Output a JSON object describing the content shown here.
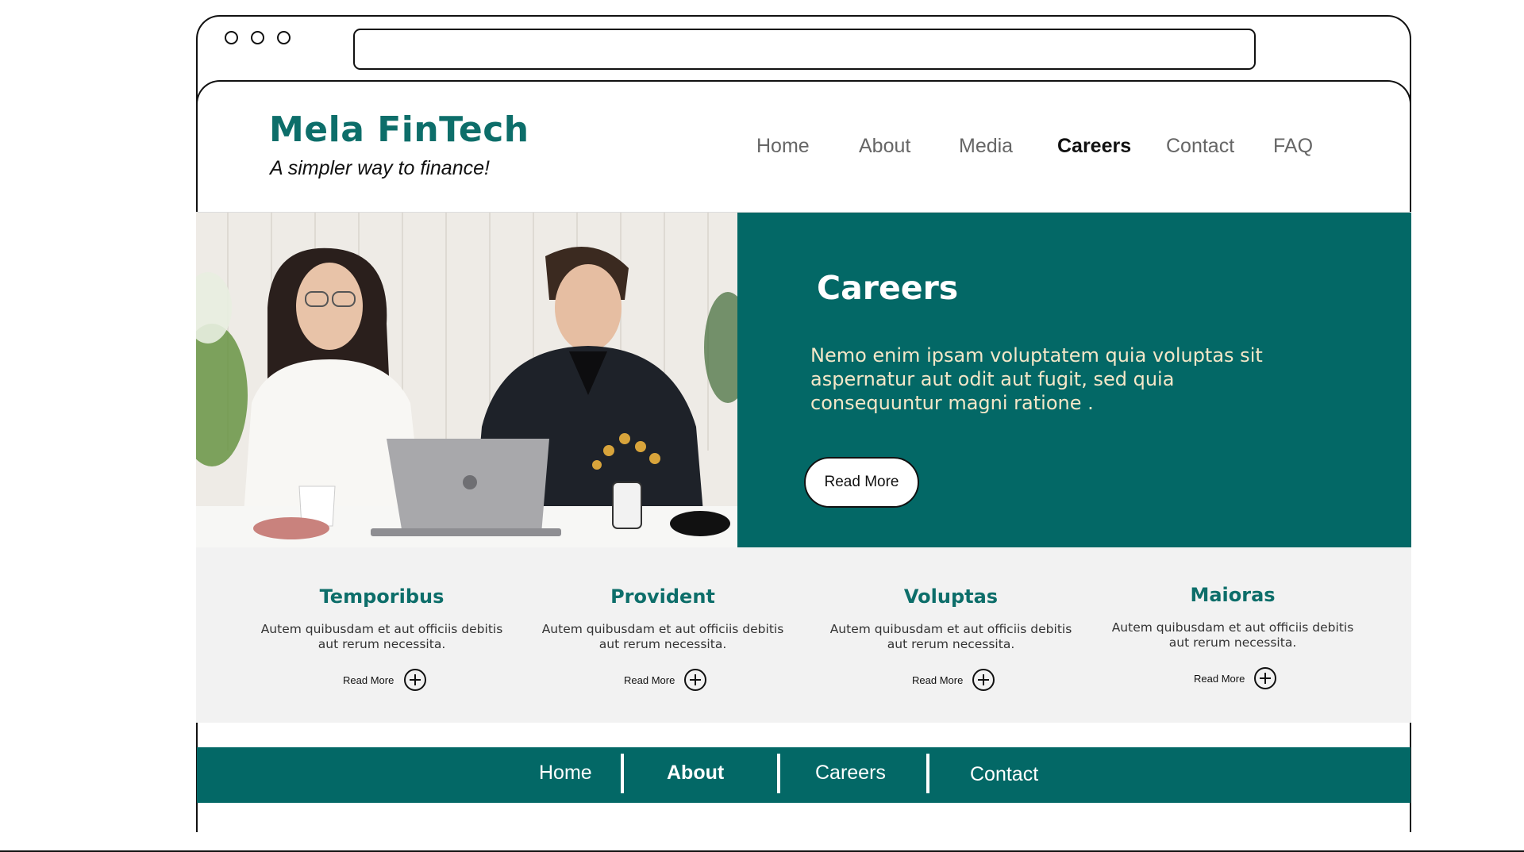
{
  "browser": {
    "address": ""
  },
  "header": {
    "brand": "Mela FinTech",
    "tagline": "A simpler way to finance!",
    "nav": [
      {
        "label": "Home"
      },
      {
        "label": "About"
      },
      {
        "label": "Media"
      },
      {
        "label": "Careers",
        "active": true
      },
      {
        "label": "Contact"
      },
      {
        "label": "FAQ"
      }
    ]
  },
  "hero": {
    "title": "Careers",
    "text": "Nemo enim ipsam voluptatem quia voluptas sit aspernatur aut odit aut fugit, sed quia consequuntur magni  ratione .",
    "button": "Read More"
  },
  "features": [
    {
      "title": "Temporibus",
      "text": "Autem quibusdam et aut officiis debitis aut rerum necessita.",
      "more": "Read More"
    },
    {
      "title": "Provident",
      "text": "Autem quibusdam et aut officiis debitis aut rerum necessita.",
      "more": "Read More"
    },
    {
      "title": "Voluptas",
      "text": "Autem quibusdam et aut officiis debitis aut rerum necessita.",
      "more": "Read More"
    },
    {
      "title": "Maioras",
      "text": "Autem quibusdam et aut officiis debitis aut rerum necessita.",
      "more": "Read More"
    }
  ],
  "footer": {
    "links": [
      {
        "label": "Home"
      },
      {
        "label": "About",
        "bold": true
      },
      {
        "label": "Careers"
      },
      {
        "label": "Contact"
      }
    ]
  },
  "colors": {
    "brand_teal": "#036866",
    "title_teal": "#0d6e6a",
    "hero_text": "#f4e7c8",
    "features_bg": "#f2f2f2"
  },
  "icons": [
    "window-control-circle",
    "plus-circle-icon",
    "hero-photo"
  ]
}
